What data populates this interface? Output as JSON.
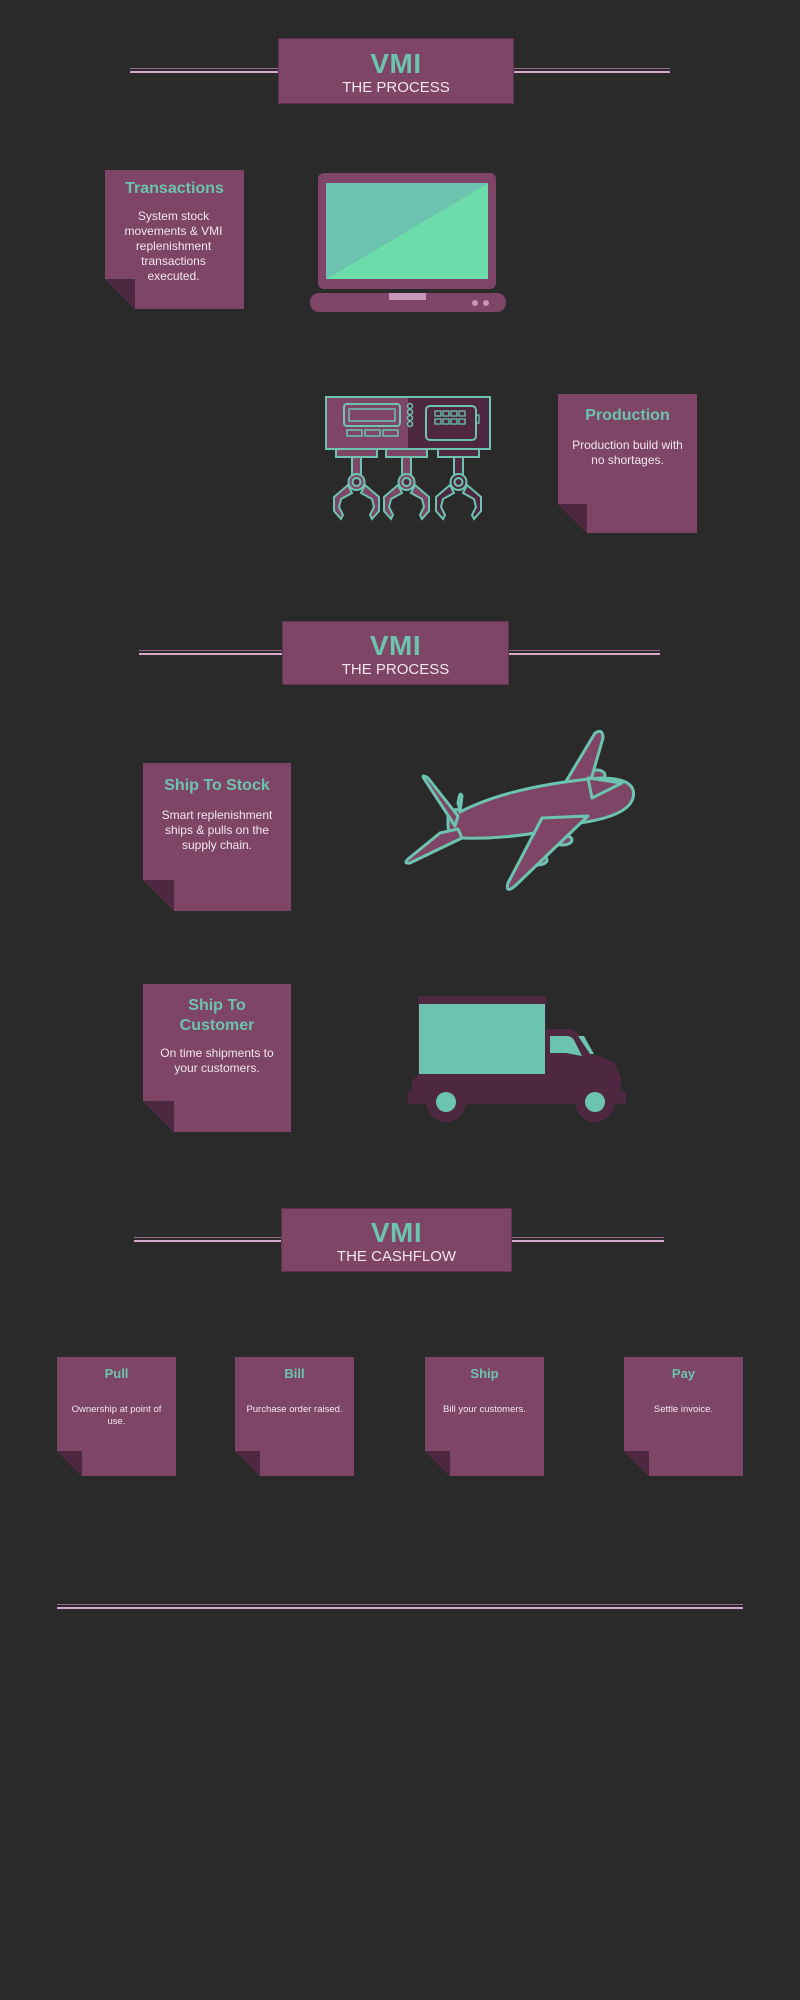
{
  "colors": {
    "background": "#2a2a2a",
    "card": "#7e4567",
    "card_fold": "#4e2840",
    "accent_teal": "#6cc4b0",
    "accent_green": "#6cdcaa",
    "text_light": "#f1e6ee",
    "line_pink": "#d9a9cc"
  },
  "banners": [
    {
      "title": "VMI",
      "subtitle": "THE PROCESS"
    },
    {
      "title": "VMI",
      "subtitle": "THE PROCESS"
    },
    {
      "title": "VMI",
      "subtitle": "THE CASHFLOW"
    }
  ],
  "process_cards": [
    {
      "title": "Transactions",
      "text": "System stock movements & VMI replenishment transactions executed.",
      "icon": "laptop-icon"
    },
    {
      "title": "Production",
      "text": "Production build with no shortages.",
      "icon": "robotic-machine-icon"
    },
    {
      "title": "Ship To Stock",
      "text": "Smart replenishment ships & pulls on the supply chain.",
      "icon": "airplane-icon"
    },
    {
      "title": "Ship To Customer",
      "text": "On time shipments to your customers.",
      "icon": "truck-icon"
    }
  ],
  "cashflow_cards": [
    {
      "title": "Pull",
      "text": "Ownership at point of use."
    },
    {
      "title": "Bill",
      "text": "Purchase order raised."
    },
    {
      "title": "Ship",
      "text": "Bill your customers."
    },
    {
      "title": "Pay",
      "text": "Settle invoice."
    }
  ]
}
